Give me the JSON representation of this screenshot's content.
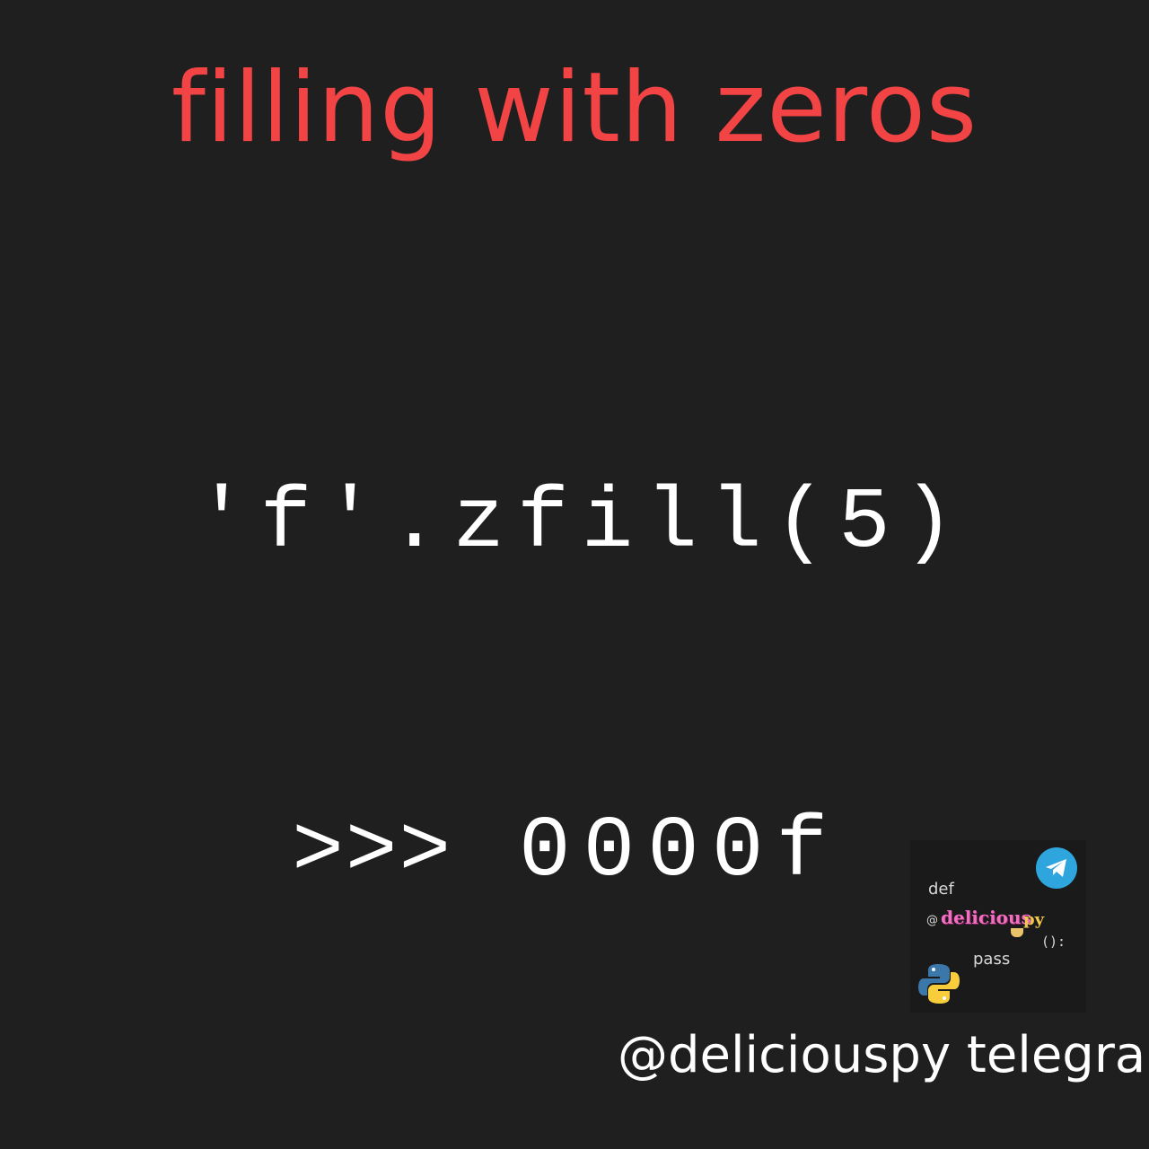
{
  "title": "filling with zeros",
  "code": {
    "expression": "'f'.zfill(5)",
    "prompt": ">>>",
    "result": "0000f"
  },
  "logo": {
    "def_keyword": "def",
    "at_sign": "@",
    "brand": "delicious",
    "brand_suffix": "py",
    "parens": "():",
    "pass_keyword": "pass",
    "icons": [
      "telegram-icon",
      "python-logo-icon",
      "coffee-cup-icon"
    ]
  },
  "footer": {
    "handle": "@deliciouspy telegram"
  },
  "colors": {
    "background": "#1f1f1f",
    "title": "#f24444",
    "code": "#ffffff",
    "telegram": "#2ea6dd",
    "brand": "#f06fbf"
  }
}
